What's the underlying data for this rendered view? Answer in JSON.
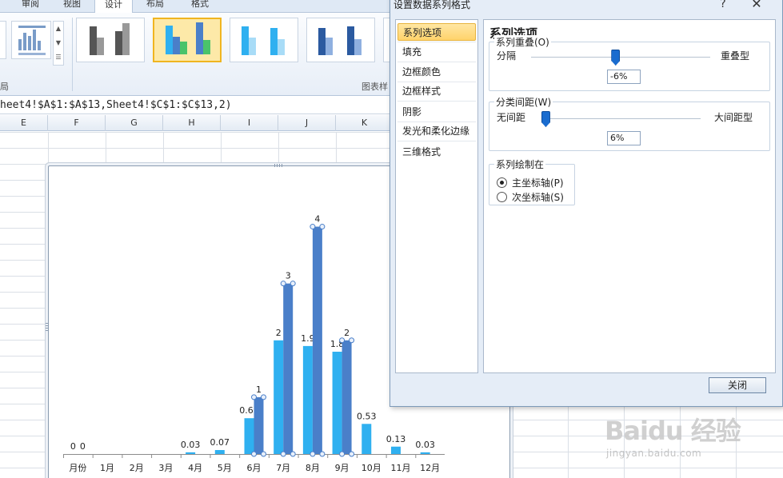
{
  "ribbon": {
    "tabs": [
      "审阅",
      "视图",
      "设计",
      "布局",
      "格式"
    ],
    "active_tab": "设计",
    "groups": {
      "chart_layout_label": "局",
      "chart_styles_label": "图表样"
    }
  },
  "formula_bar": {
    "text": "heet4!$A$1:$A$13,Sheet4!$C$1:$C$13,2)"
  },
  "columns": [
    "E",
    "F",
    "G",
    "H",
    "I",
    "J",
    "K"
  ],
  "chart_data": {
    "type": "bar",
    "categories": [
      "月份",
      "1月",
      "2月",
      "3月",
      "4月",
      "5月",
      "6月",
      "7月",
      "8月",
      "9月",
      "10月",
      "11月",
      "12月"
    ],
    "series": [
      {
        "values": [
          0,
          0,
          0,
          0,
          0.03,
          0.07,
          0.63,
          2,
          1.9,
          1.8,
          0.53,
          0.13,
          0.03
        ],
        "labels": [
          "0",
          "",
          "",
          "",
          "0.03",
          "0.07",
          "0.63",
          "2",
          "1.9",
          "1.8",
          "0.53",
          "0.13",
          "0.03"
        ],
        "color": "#2fb0f0"
      },
      {
        "values": [
          0,
          0,
          0,
          0,
          0,
          0,
          1,
          3,
          4,
          2,
          0,
          0,
          0
        ],
        "labels": [
          "0",
          "",
          "",
          "",
          "",
          "",
          "1",
          "3",
          "4",
          "2",
          "",
          "",
          ""
        ],
        "color": "#4a7fc9"
      }
    ],
    "ylim": [
      0,
      4.5
    ],
    "xlabel": "",
    "ylabel": "",
    "title": "",
    "grid": false,
    "legend": "none",
    "selected_series": 2
  },
  "dialog": {
    "title": "设置数据系列格式",
    "help": "?",
    "close_x": "✕",
    "nav_items": [
      "系列选项",
      "填充",
      "边框颜色",
      "边框样式",
      "阴影",
      "发光和柔化边缘",
      "三维格式"
    ],
    "selected_nav": 0,
    "content_title": "系列选项",
    "overlap": {
      "legend": "系列重叠(O)",
      "left_label": "分隔",
      "right_label": "重叠型",
      "value": "-6%",
      "fraction": 0.47
    },
    "gap": {
      "legend": "分类间距(W)",
      "left_label": "无间距",
      "right_label": "大间距型",
      "value": "6%",
      "fraction": 0.01
    },
    "plot_on": {
      "legend": "系列绘制在",
      "options": [
        "主坐标轴(P)",
        "次坐标轴(S)"
      ],
      "selected": 0
    },
    "close_button": "关闭"
  },
  "watermark": {
    "logo": "Baidu 经验",
    "url": "jingyan.baidu.com"
  },
  "colors": {
    "series1": "#2fb0f0",
    "series2": "#4a7fc9",
    "accent": "#ffd36b",
    "slider": "#1a6ccf"
  }
}
